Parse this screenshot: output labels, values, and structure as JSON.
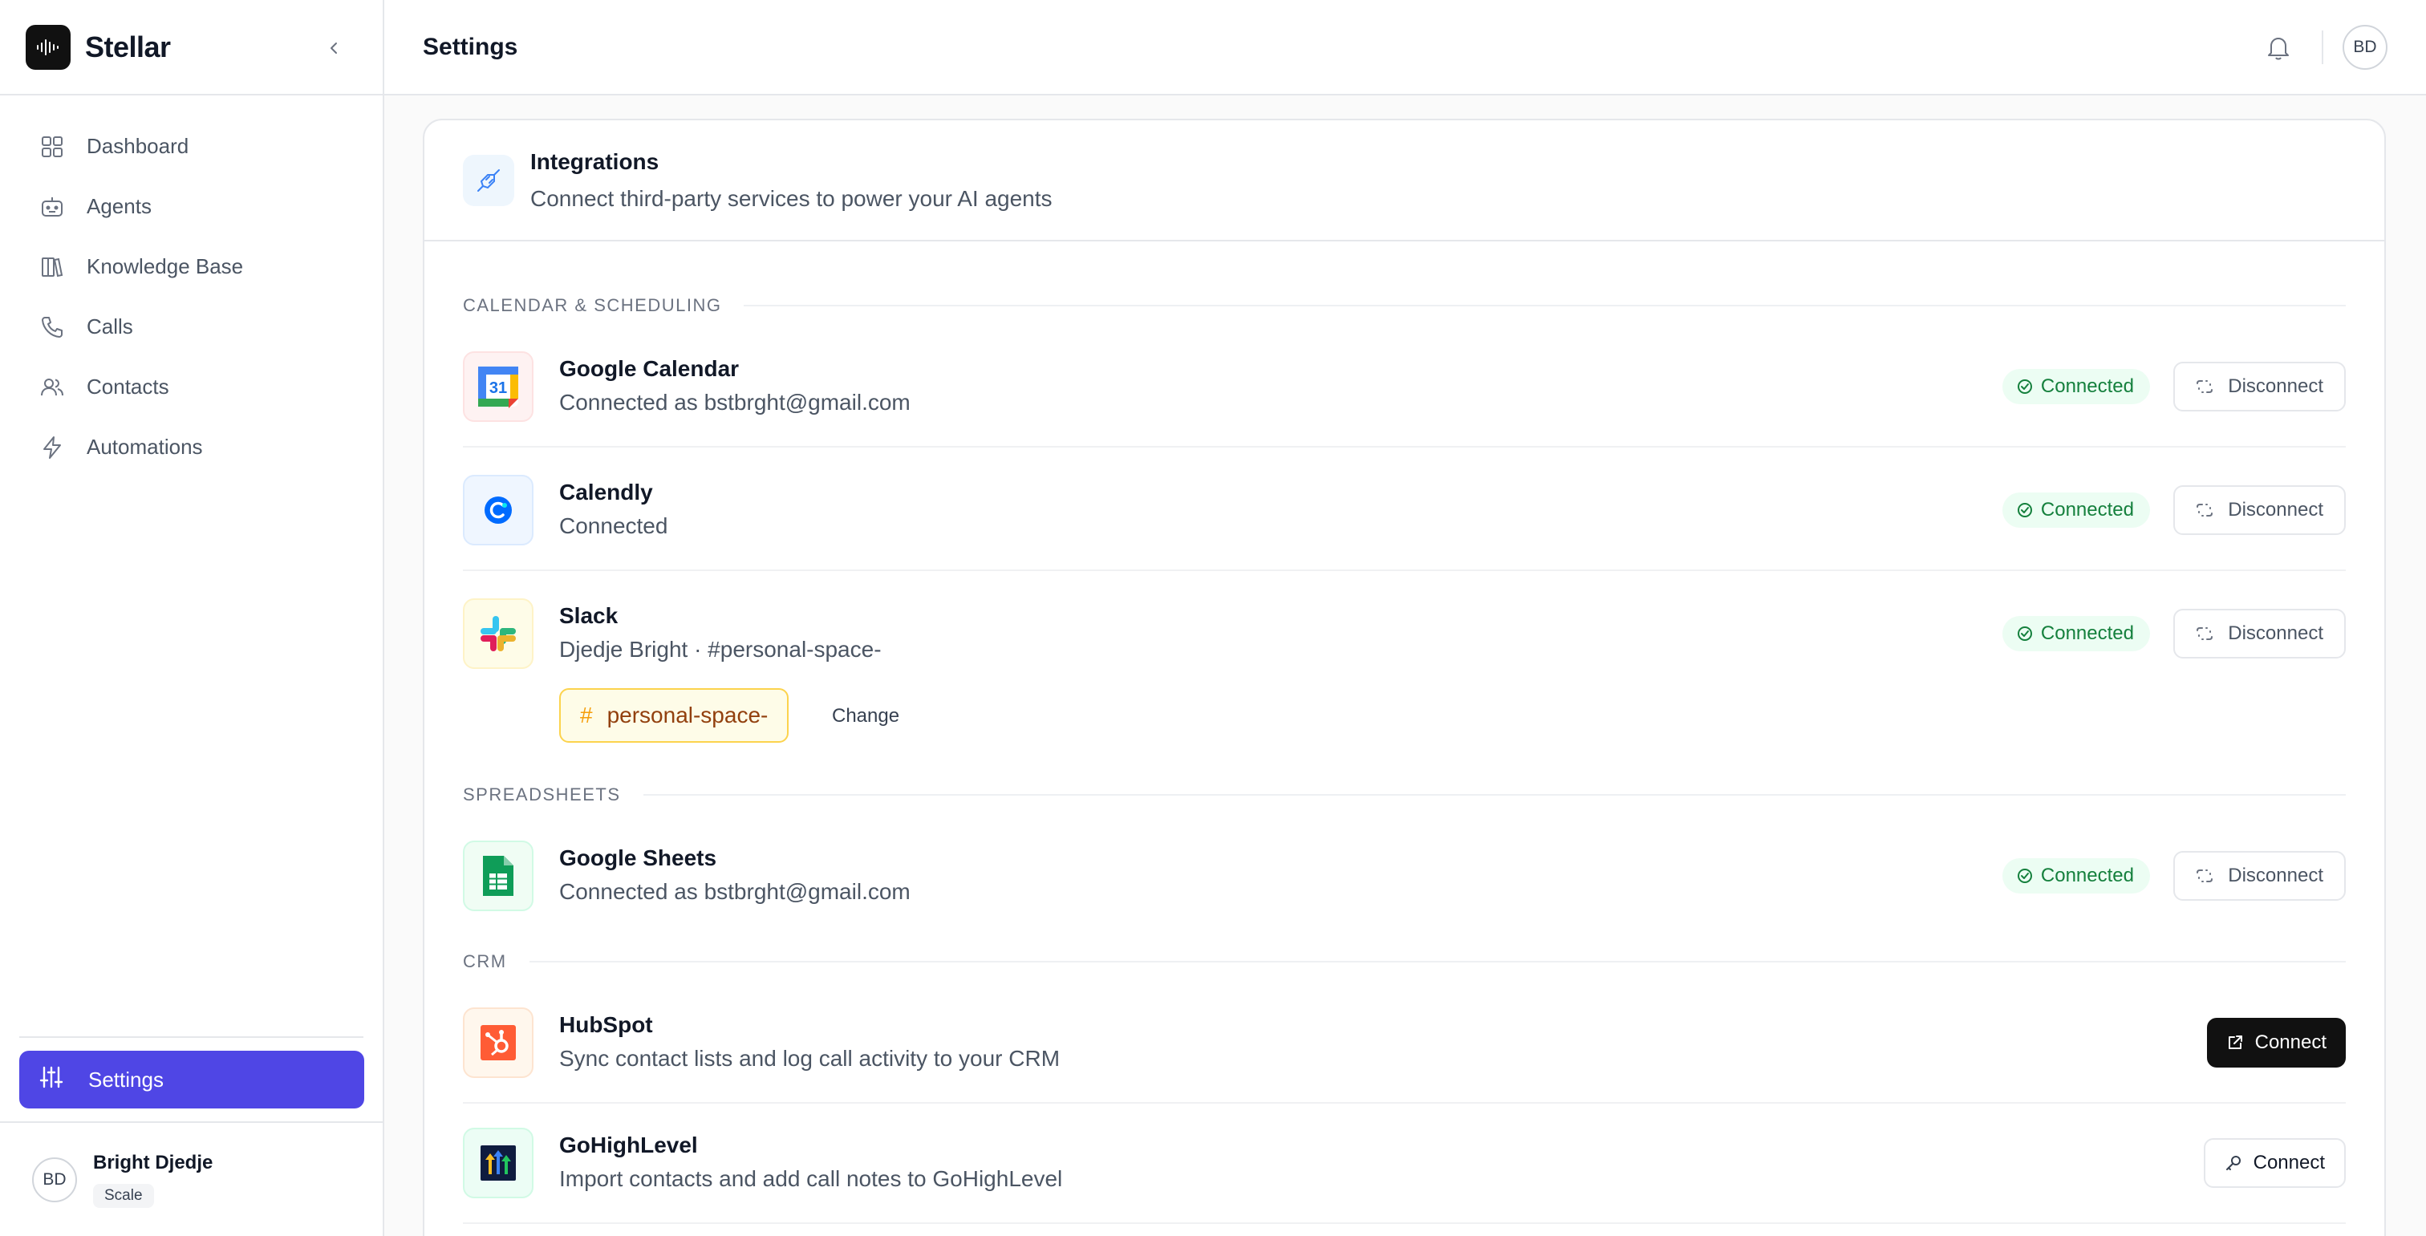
{
  "app": {
    "name": "Stellar"
  },
  "sidebar": {
    "items": [
      {
        "label": "Dashboard",
        "icon": "grid-icon"
      },
      {
        "label": "Agents",
        "icon": "robot-icon"
      },
      {
        "label": "Knowledge Base",
        "icon": "books-icon"
      },
      {
        "label": "Calls",
        "icon": "phone-icon"
      },
      {
        "label": "Contacts",
        "icon": "users-icon"
      },
      {
        "label": "Automations",
        "icon": "lightning-icon"
      }
    ],
    "settings_label": "Settings",
    "user": {
      "initials": "BD",
      "name": "Bright Djedje",
      "plan": "Scale"
    }
  },
  "header": {
    "title": "Settings",
    "avatar_initials": "BD"
  },
  "integrations": {
    "title": "Integrations",
    "subtitle": "Connect third-party services to power your AI agents",
    "sections": {
      "calendar": "CALENDAR & SCHEDULING",
      "spreadsheets": "SPREADSHEETS",
      "crm": "CRM"
    },
    "items": [
      {
        "name": "Google Calendar",
        "subtitle": "Connected as bstbrght@gmail.com",
        "status": "Connected",
        "action": "Disconnect"
      },
      {
        "name": "Calendly",
        "subtitle": "Connected",
        "status": "Connected",
        "action": "Disconnect"
      },
      {
        "name": "Slack",
        "subtitle": "Djedje Bright · #personal-space-",
        "status": "Connected",
        "action": "Disconnect",
        "channel": "personal-space-",
        "change_label": "Change"
      },
      {
        "name": "Google Sheets",
        "subtitle": "Connected as bstbrght@gmail.com",
        "status": "Connected",
        "action": "Disconnect"
      },
      {
        "name": "HubSpot",
        "subtitle": "Sync contact lists and log call activity to your CRM",
        "action": "Connect"
      },
      {
        "name": "GoHighLevel",
        "subtitle": "Import contacts and add call notes to GoHighLevel",
        "action": "Connect"
      }
    ]
  },
  "colors": {
    "accent": "#4f46e5",
    "connected_green": "#15803d",
    "dark_button": "#111111"
  }
}
